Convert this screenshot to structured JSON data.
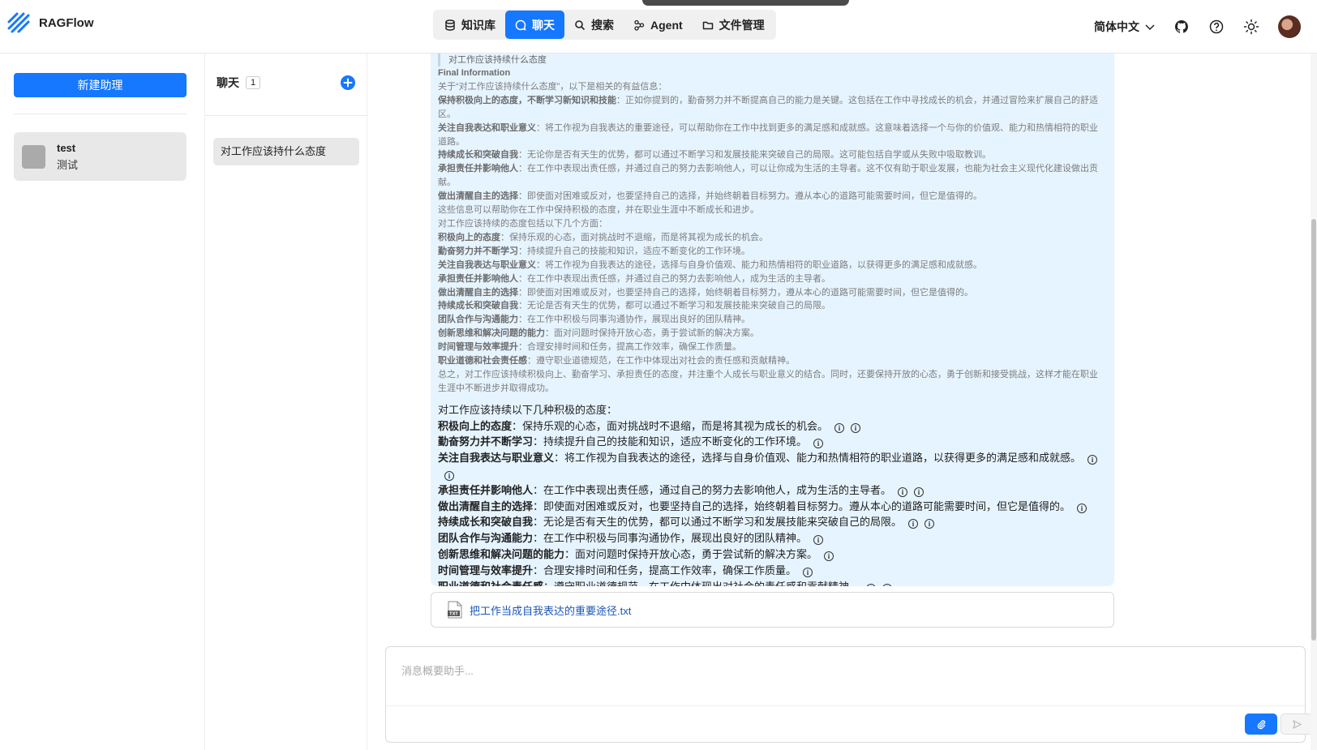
{
  "app": {
    "name": "RAGFlow"
  },
  "nav": [
    {
      "label": "知识库",
      "icon": "database-icon",
      "active": false
    },
    {
      "label": "聊天",
      "icon": "chat-icon",
      "active": true
    },
    {
      "label": "搜索",
      "icon": "search-icon",
      "active": false
    },
    {
      "label": "Agent",
      "icon": "agent-icon",
      "active": false
    },
    {
      "label": "文件管理",
      "icon": "folder-icon",
      "active": false
    }
  ],
  "header": {
    "language": "简体中文"
  },
  "assistants": {
    "new_button": "新建助理",
    "items": [
      {
        "name": "test",
        "description": "测试"
      }
    ]
  },
  "chats": {
    "title": "聊天",
    "count": "1",
    "items": [
      {
        "title": "对工作应该持什么态度"
      }
    ]
  },
  "message": {
    "quote": "对工作应该持续什么态度",
    "reference_rows": [
      {
        "b": "Final Information",
        "t": ""
      },
      {
        "b": "",
        "t": "关于“对工作应该持续什么态度”，以下是相关的有益信息："
      },
      {
        "b": "保持积极向上的态度，不断学习新知识和技能",
        "t": "：正如你提到的，勤奋努力并不断提高自己的能力是关键。这包括在工作中寻找成长的机会，并通过冒险来扩展自己的舒适区。"
      },
      {
        "b": "关注自我表达和职业意义",
        "t": "：将工作视为自我表达的重要途径，可以帮助你在工作中找到更多的满足感和成就感。这意味着选择一个与你的价值观、能力和热情相符的职业道路。"
      },
      {
        "b": "持续成长和突破自我",
        "t": "：无论你是否有天生的优势，都可以通过不断学习和发展技能来突破自己的局限。这可能包括自学或从失败中吸取教训。"
      },
      {
        "b": "承担责任并影响他人",
        "t": "：在工作中表现出责任感，并通过自己的努力去影响他人，可以让你成为生活的主导者。这不仅有助于职业发展，也能为社会主义现代化建设做出贡献。"
      },
      {
        "b": "做出清醒自主的选择",
        "t": "：即使面对困难或反对，也要坚持自己的选择，并始终朝着目标努力。遵从本心的道路可能需要时间，但它是值得的。"
      },
      {
        "b": "",
        "t": "这些信息可以帮助你在工作中保持积极的态度，并在职业生涯中不断成长和进步。"
      },
      {
        "b": "",
        "t": "对工作应该持续的态度包括以下几个方面："
      },
      {
        "b": "积极向上的态度",
        "t": "：保持乐观的心态，面对挑战时不退缩，而是将其视为成长的机会。"
      },
      {
        "b": "勤奋努力并不断学习",
        "t": "：持续提升自己的技能和知识，适应不断变化的工作环境。"
      },
      {
        "b": "关注自我表达与职业意义",
        "t": "：将工作视为自我表达的途径，选择与自身价值观、能力和热情相符的职业道路，以获得更多的满足感和成就感。"
      },
      {
        "b": "承担责任并影响他人",
        "t": "：在工作中表现出责任感，并通过自己的努力去影响他人，成为生活的主导者。"
      },
      {
        "b": "做出清醒自主的选择",
        "t": "：即使面对困难或反对，也要坚持自己的选择，始终朝着目标努力，遵从本心的道路可能需要时间，但它是值得的。"
      },
      {
        "b": "持续成长和突破自我",
        "t": "：无论是否有天生的优势，都可以通过不断学习和发展技能来突破自己的局限。"
      },
      {
        "b": "团队合作与沟通能力",
        "t": "：在工作中积极与同事沟通协作，展现出良好的团队精神。"
      },
      {
        "b": "创新思维和解决问题的能力",
        "t": "：面对问题时保持开放心态，勇于尝试新的解决方案。"
      },
      {
        "b": "时间管理与效率提升",
        "t": "：合理安排时间和任务，提高工作效率，确保工作质量。"
      },
      {
        "b": "职业道德和社会责任感",
        "t": "：遵守职业道德规范，在工作中体现出对社会的责任感和贡献精神。"
      },
      {
        "b": "",
        "t": "总之，对工作应该持续积极向上、勤奋学习、承担责任的态度，并注重个人成长与职业意义的结合。同时，还要保持开放的心态，勇于创新和接受挑战，这样才能在职业生涯中不断进步并取得成功。"
      }
    ],
    "answer_intro": "对工作应该持续以下几种积极的态度：",
    "answer_rows": [
      {
        "b": "积极向上的态度",
        "t": "：保持乐观的心态，面对挑战时不退缩，而是将其视为成长的机会。",
        "cites": 2
      },
      {
        "b": "勤奋努力并不断学习",
        "t": "：持续提升自己的技能和知识，适应不断变化的工作环境。",
        "cites": 1
      },
      {
        "b": "关注自我表达与职业意义",
        "t": "：将工作视为自我表达的途径，选择与自身价值观、能力和热情相符的职业道路，以获得更多的满足感和成就感。",
        "cites": 2
      },
      {
        "b": "承担责任并影响他人",
        "t": "：在工作中表现出责任感，通过自己的努力去影响他人，成为生活的主导者。",
        "cites": 2
      },
      {
        "b": "做出清醒自主的选择",
        "t": "：即使面对困难或反对，也要坚持自己的选择，始终朝着目标努力。遵从本心的道路可能需要时间，但它是值得的。",
        "cites": 1
      },
      {
        "b": "持续成长和突破自我",
        "t": "：无论是否有天生的优势，都可以通过不断学习和发展技能来突破自己的局限。",
        "cites": 2
      },
      {
        "b": "团队合作与沟通能力",
        "t": "：在工作中积极与同事沟通协作，展现出良好的团队精神。",
        "cites": 1
      },
      {
        "b": "创新思维和解决问题的能力",
        "t": "：面对问题时保持开放心态，勇于尝试新的解决方案。",
        "cites": 1
      },
      {
        "b": "时间管理与效率提升",
        "t": "：合理安排时间和任务，提高工作效率，确保工作质量。",
        "cites": 1
      },
      {
        "b": "职业道德和社会责任感",
        "t": "：遵守职业道德规范，在工作中体现出对社会的责任感和贡献精神。",
        "cites": 2
      }
    ],
    "citation_glyph": "i",
    "document": {
      "name": "把工作当成自我表达的重要途径.txt",
      "type": "TXT"
    }
  },
  "composer": {
    "placeholder": "消息概要助手..."
  },
  "colors": {
    "accent": "#1677ff",
    "message_bg": "#e6f4ff"
  }
}
